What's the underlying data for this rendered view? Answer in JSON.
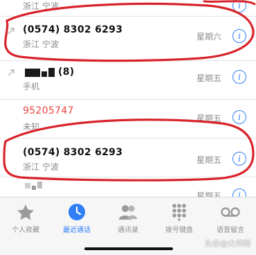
{
  "accent_color": "#2f7ef6",
  "missed_color": "#e8453c",
  "annotation_color": "#d8232a",
  "calls": [
    {
      "number": "",
      "label": "浙江 宁波",
      "day": "",
      "info_icon": "info-icon",
      "partially_visible": true
    },
    {
      "number": "(0574) 8302 6293",
      "label": "浙江 宁波",
      "day": "星期六",
      "info_icon": "info-icon",
      "type_icon": "outgoing-call-icon"
    },
    {
      "number": "(8)",
      "label": "手机",
      "day": "星期五",
      "info_icon": "info-icon",
      "type_icon": "outgoing-call-icon",
      "redacted": true
    },
    {
      "number": "95205747",
      "label": "未知",
      "day": "星期五",
      "info_icon": "info-icon",
      "missed": true
    },
    {
      "number": "(0574) 8302 6293",
      "label": "浙江 宁波",
      "day": "星期五",
      "info_icon": "info-icon"
    },
    {
      "number": "",
      "label": "",
      "day": "星期五",
      "info_icon": "info-icon",
      "partially_visible": true,
      "redacted": true
    }
  ],
  "tabs": [
    {
      "label": "个人收藏",
      "icon": "star-icon",
      "active": false
    },
    {
      "label": "最近通话",
      "icon": "clock-icon",
      "active": true
    },
    {
      "label": "通讯录",
      "icon": "contacts-icon",
      "active": false
    },
    {
      "label": "拨号键盘",
      "icon": "keypad-icon",
      "active": false
    },
    {
      "label": "语音留言",
      "icon": "voicemail-icon",
      "active": false
    }
  ],
  "watermark": "头条@大洋网"
}
